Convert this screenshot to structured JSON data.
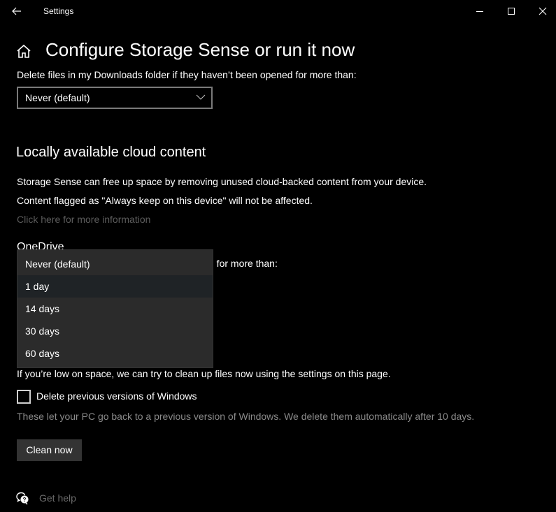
{
  "titlebar": {
    "title": "Settings",
    "back_icon": "arrow-left-icon",
    "minimize_icon": "minimize-icon",
    "maximize_icon": "maximize-icon",
    "close_icon": "close-icon"
  },
  "header": {
    "home_icon": "home-icon",
    "title": "Configure Storage Sense or run it now"
  },
  "downloads": {
    "label": "Delete files in my Downloads folder if they haven’t been opened for more than:",
    "selected": "Never (default)"
  },
  "cloud": {
    "title": "Locally available cloud content",
    "desc1": "Storage Sense can free up space by removing unused cloud-backed content from your device.",
    "desc2": "Content flagged as \"Always keep on this device\" will not be affected.",
    "more_link": "Click here for more information",
    "onedrive_title": "OneDrive",
    "onedrive_label_tail": "d for more than:"
  },
  "dropdown": {
    "options": [
      "Never (default)",
      "1 day",
      "14 days",
      "30 days",
      "60 days"
    ],
    "highlighted_index": 1
  },
  "clean": {
    "desc": "If you’re low on space, we can try to clean up files now using the settings on this page.",
    "checkbox_label": "Delete previous versions of Windows",
    "checkbox_checked": false,
    "checkbox_note": "These let your PC go back to a previous version of Windows. We delete them automatically after 10 days.",
    "button": "Clean now"
  },
  "help": {
    "icon": "help-chat-icon",
    "label": "Get help"
  }
}
